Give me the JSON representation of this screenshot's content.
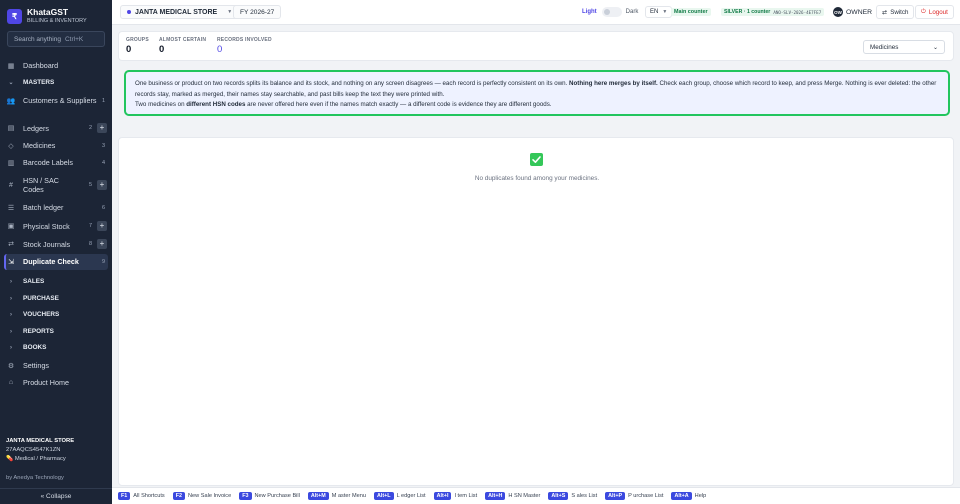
{
  "app": {
    "name": "KhataGST",
    "subtitle": "BILLING & INVENTORY",
    "logo": "₹"
  },
  "sidebar": {
    "search_placeholder": "Search anything",
    "search_shortcut": "Ctrl+K",
    "dashboard": "Dashboard",
    "masters": "MASTERS",
    "items": [
      {
        "label": "Customers & Suppliers",
        "count": "1"
      },
      {
        "label": "Ledgers",
        "count": "2"
      },
      {
        "label": "Medicines",
        "count": "3"
      },
      {
        "label": "Barcode Labels",
        "count": "4"
      },
      {
        "label": "HSN / SAC Codes",
        "count": "5"
      },
      {
        "label": "Batch ledger",
        "count": "6"
      },
      {
        "label": "Physical Stock",
        "count": "7"
      },
      {
        "label": "Stock Journals",
        "count": "8"
      },
      {
        "label": "Duplicate Check",
        "count": "9"
      }
    ],
    "sections": [
      "SALES",
      "PURCHASE",
      "VOUCHERS",
      "REPORTS",
      "BOOKS"
    ],
    "settings": "Settings",
    "product_home": "Product Home",
    "company": {
      "name": "JANTA MEDICAL STORE",
      "gstin": "27AAQCS4547K1ZN",
      "type": "Medical / Pharmacy"
    },
    "by": "by Anedya Technology",
    "collapse": "« Collapse"
  },
  "topbar": {
    "store": "JANTA MEDICAL STORE",
    "fy": "FY 2026-27",
    "theme_light": "Light",
    "theme_dark": "Dark",
    "lang": "EN",
    "main_counter": "Main counter",
    "license": "SILVER · 1 counter",
    "license_code": "ANO-SLV-2026-4E7FE7",
    "owner_initials": "OW",
    "owner": "OWNER",
    "switch": "Switch",
    "logout": "Logout"
  },
  "stats": {
    "groups_label": "GROUPS",
    "groups_value": "0",
    "almost_label": "ALMOST CERTAIN",
    "almost_value": "0",
    "records_label": "RECORDS INVOLVED",
    "records_value": "0",
    "scope": "Medicines"
  },
  "notice": {
    "line1a": "One business or product on two records splits its balance and its stock, and nothing on any screen disagrees — each record is perfectly consistent on its own. ",
    "line1b": "Nothing here merges by itself.",
    "line1c": " Check each group, choose which record to keep, and press Merge. Nothing is ever deleted: the other records stay, marked as merged, their names stay searchable, and past bills keep the text they were printed with.",
    "line2a": "Two medicines on ",
    "line2b": "different HSN codes",
    "line2c": " are never offered here even if the names match exactly — a different code is evidence they are different goods."
  },
  "content": {
    "empty": "No duplicates found among your medicines."
  },
  "shortcuts": [
    {
      "key": "F1",
      "label": "All Shortcuts"
    },
    {
      "key": "F2",
      "label": "New Sale Invoice"
    },
    {
      "key": "F3",
      "label": "New Purchase Bill"
    },
    {
      "key": "Alt+M",
      "label": "M aster Menu"
    },
    {
      "key": "Alt+L",
      "label": "L edger List"
    },
    {
      "key": "Alt+I",
      "label": "I tem List"
    },
    {
      "key": "Alt+H",
      "label": "H SN Master"
    },
    {
      "key": "Alt+S",
      "label": "S ales List"
    },
    {
      "key": "Alt+P",
      "label": "P urchase List"
    },
    {
      "key": "Alt+A",
      "label": "Help"
    }
  ],
  "colors": {
    "sidebar_bg": "#1c2536",
    "accent": "#4f46e5",
    "notice_border": "#22c55e",
    "success": "#34c759"
  }
}
